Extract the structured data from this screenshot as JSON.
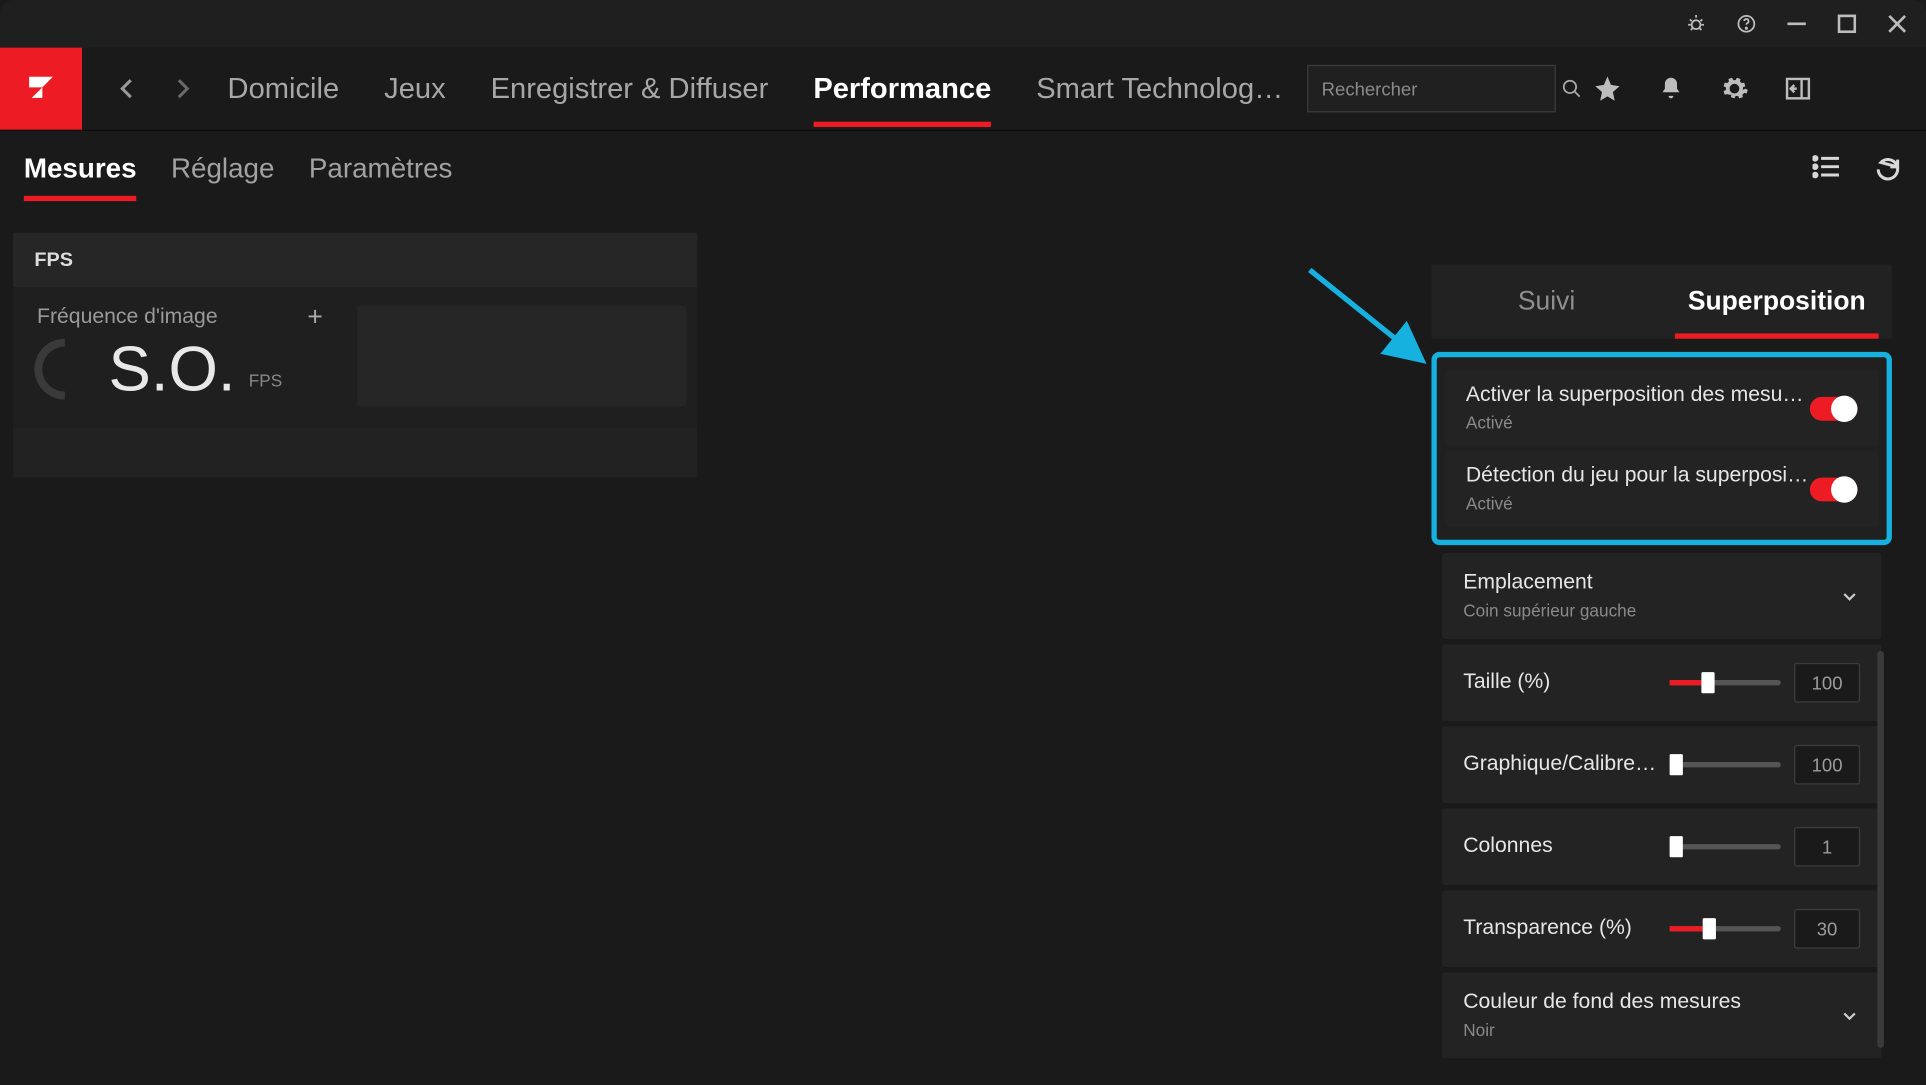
{
  "titlebar": {
    "icons": [
      "bug",
      "help",
      "minimize",
      "maximize",
      "close"
    ]
  },
  "nav": {
    "tabs": [
      "Domicile",
      "Jeux",
      "Enregistrer & Diffuser",
      "Performance",
      "Smart Technolog…"
    ],
    "active_index": 3
  },
  "search": {
    "placeholder": "Rechercher"
  },
  "subnav": {
    "tabs": [
      "Mesures",
      "Réglage",
      "Paramètres"
    ],
    "active_index": 0
  },
  "fps_card": {
    "header": "FPS",
    "label": "Fréquence d'image",
    "value": "S.O.",
    "unit": "FPS"
  },
  "right_tabs": {
    "items": [
      "Suivi",
      "Superposition"
    ],
    "active_index": 1
  },
  "overlay_settings": {
    "activate": {
      "title": "Activer la superposition des mesures",
      "status": "Activé"
    },
    "detect": {
      "title": "Détection du jeu pour la superpositio…",
      "status": "Activé"
    },
    "location": {
      "title": "Emplacement",
      "value": "Coin supérieur gauche"
    },
    "size": {
      "title": "Taille (%)",
      "value": "100",
      "fill_pct": 28
    },
    "gauge": {
      "title": "Graphique/Calibre (%)",
      "value": "100",
      "fill_pct": 0
    },
    "columns": {
      "title": "Colonnes",
      "value": "1",
      "fill_pct": 0
    },
    "transparency": {
      "title": "Transparence (%)",
      "value": "30",
      "fill_pct": 30
    },
    "bgcolor": {
      "title": "Couleur de fond des mesures",
      "value": "Noir"
    }
  }
}
